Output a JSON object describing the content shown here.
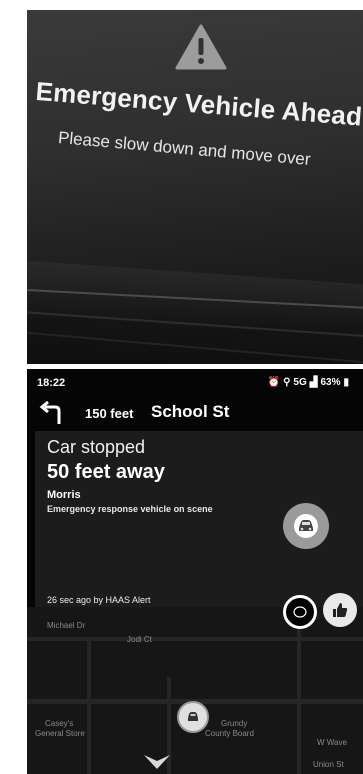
{
  "photo": {
    "headline": "Emergency Vehicle Ahead",
    "subline": "Please slow down and move over",
    "icon": "warning-triangle-icon"
  },
  "status_bar": {
    "time": "18:22",
    "network": "5G",
    "battery": "63%"
  },
  "nav": {
    "turn_icon": "turn-left-icon",
    "distance": "150 feet",
    "street": "School St"
  },
  "alert": {
    "title": "Car stopped",
    "distance": "50 feet away",
    "place": "Morris",
    "description": "Emergency response vehicle on scene",
    "meta": "26 sec ago by HAAS Alert",
    "car_icon": "car-icon"
  },
  "map": {
    "labels": {
      "michael": "Michael Dr",
      "jodi": "Jodi Ct",
      "caseys_1": "Casey's",
      "caseys_2": "General Store",
      "grundy_1": "Grundy",
      "grundy_2": "County Board",
      "wwave": "W Wave",
      "union": "Union St"
    }
  }
}
